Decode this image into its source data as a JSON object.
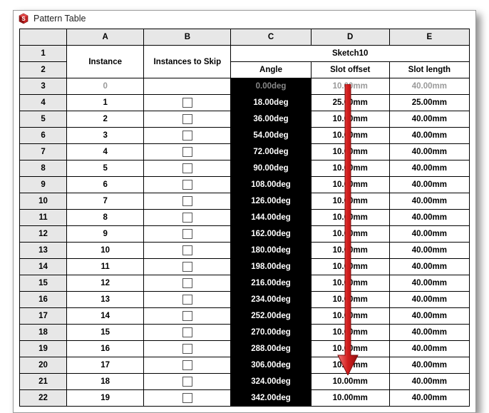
{
  "window": {
    "title": "Pattern Table"
  },
  "columns": {
    "letters": [
      "A",
      "B",
      "C",
      "D",
      "E"
    ],
    "instance_header": "Instance",
    "skip_header": "Instances to Skip",
    "sketch_header": "Sketch10",
    "sub": {
      "angle": "Angle",
      "slot_offset": "Slot offset",
      "slot_length": "Slot length"
    }
  },
  "row_labels": [
    "1",
    "2",
    "3",
    "4",
    "5",
    "6",
    "7",
    "8",
    "9",
    "10",
    "11",
    "12",
    "13",
    "14",
    "15",
    "16",
    "17",
    "18",
    "19",
    "20",
    "21",
    "22"
  ],
  "rows": [
    {
      "instance": "0",
      "skip": null,
      "angle": "0.00deg",
      "offset": "10.00mm",
      "length": "40.00mm",
      "disabled": true
    },
    {
      "instance": "1",
      "skip": false,
      "angle": "18.00deg",
      "offset": "25.00mm",
      "length": "25.00mm",
      "disabled": false
    },
    {
      "instance": "2",
      "skip": false,
      "angle": "36.00deg",
      "offset": "10.00mm",
      "length": "40.00mm",
      "disabled": false
    },
    {
      "instance": "3",
      "skip": false,
      "angle": "54.00deg",
      "offset": "10.00mm",
      "length": "40.00mm",
      "disabled": false
    },
    {
      "instance": "4",
      "skip": false,
      "angle": "72.00deg",
      "offset": "10.00mm",
      "length": "40.00mm",
      "disabled": false
    },
    {
      "instance": "5",
      "skip": false,
      "angle": "90.00deg",
      "offset": "10.00mm",
      "length": "40.00mm",
      "disabled": false
    },
    {
      "instance": "6",
      "skip": false,
      "angle": "108.00deg",
      "offset": "10.00mm",
      "length": "40.00mm",
      "disabled": false
    },
    {
      "instance": "7",
      "skip": false,
      "angle": "126.00deg",
      "offset": "10.00mm",
      "length": "40.00mm",
      "disabled": false
    },
    {
      "instance": "8",
      "skip": false,
      "angle": "144.00deg",
      "offset": "10.00mm",
      "length": "40.00mm",
      "disabled": false
    },
    {
      "instance": "9",
      "skip": false,
      "angle": "162.00deg",
      "offset": "10.00mm",
      "length": "40.00mm",
      "disabled": false
    },
    {
      "instance": "10",
      "skip": false,
      "angle": "180.00deg",
      "offset": "10.00mm",
      "length": "40.00mm",
      "disabled": false
    },
    {
      "instance": "11",
      "skip": false,
      "angle": "198.00deg",
      "offset": "10.00mm",
      "length": "40.00mm",
      "disabled": false
    },
    {
      "instance": "12",
      "skip": false,
      "angle": "216.00deg",
      "offset": "10.00mm",
      "length": "40.00mm",
      "disabled": false
    },
    {
      "instance": "13",
      "skip": false,
      "angle": "234.00deg",
      "offset": "10.00mm",
      "length": "40.00mm",
      "disabled": false
    },
    {
      "instance": "14",
      "skip": false,
      "angle": "252.00deg",
      "offset": "10.00mm",
      "length": "40.00mm",
      "disabled": false
    },
    {
      "instance": "15",
      "skip": false,
      "angle": "270.00deg",
      "offset": "10.00mm",
      "length": "40.00mm",
      "disabled": false
    },
    {
      "instance": "16",
      "skip": false,
      "angle": "288.00deg",
      "offset": "10.00mm",
      "length": "40.00mm",
      "disabled": false
    },
    {
      "instance": "17",
      "skip": false,
      "angle": "306.00deg",
      "offset": "10.00mm",
      "length": "40.00mm",
      "disabled": false
    },
    {
      "instance": "18",
      "skip": false,
      "angle": "324.00deg",
      "offset": "10.00mm",
      "length": "40.00mm",
      "disabled": false
    },
    {
      "instance": "19",
      "skip": false,
      "angle": "342.00deg",
      "offset": "10.00mm",
      "length": "40.00mm",
      "disabled": false
    }
  ],
  "arrow_color": "#d31d1d"
}
